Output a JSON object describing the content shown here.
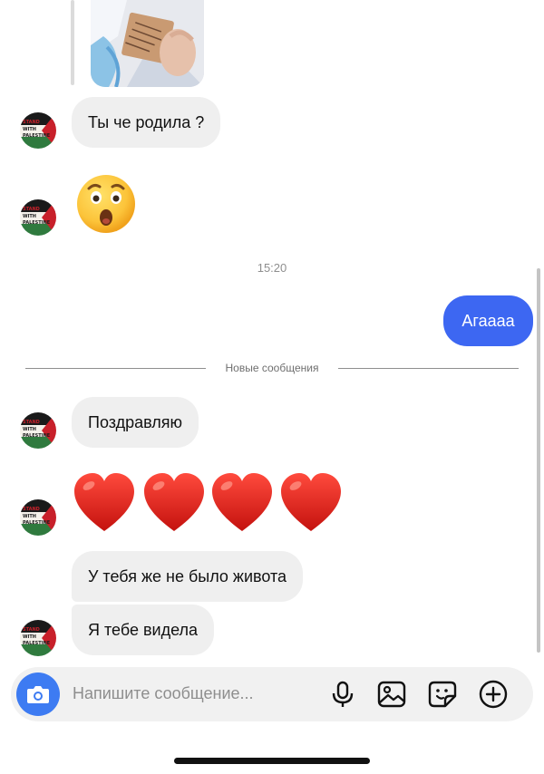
{
  "thread": {
    "messages": [
      {
        "id": "m1",
        "text": "Ты че родила ?",
        "direction": "in"
      },
      {
        "id": "m2",
        "emoji": "😲",
        "direction": "in"
      },
      {
        "id": "m3",
        "text": "Агаааа",
        "direction": "out"
      },
      {
        "id": "m4",
        "text": "Поздравляю",
        "direction": "in"
      },
      {
        "id": "m5",
        "emoji": "❤️ ❤️ ❤️ ❤️",
        "direction": "in"
      },
      {
        "id": "m6",
        "text": "У тебя же не было живота",
        "direction": "in"
      },
      {
        "id": "m7",
        "text": "Я тебе видела",
        "direction": "in"
      }
    ],
    "timestamp": "15:20",
    "new_messages_label": "Новые сообщения"
  },
  "avatar": {
    "lines": [
      "STAND",
      "WITH",
      "PALESTINE"
    ],
    "colors": {
      "top": "#1a1a1a",
      "middle": "#f4f1ea",
      "bottom": "#2f7a3e",
      "triangle": "#c8202a"
    }
  },
  "composer": {
    "placeholder": "Напишите сообщение...",
    "icons": [
      "camera-icon",
      "microphone-icon",
      "gallery-icon",
      "sticker-icon",
      "plus-circle-icon"
    ]
  },
  "colors": {
    "outgoing_bubble": "#3d67f2",
    "incoming_bubble": "#efefef",
    "camera_button": "#3d7bf2"
  }
}
